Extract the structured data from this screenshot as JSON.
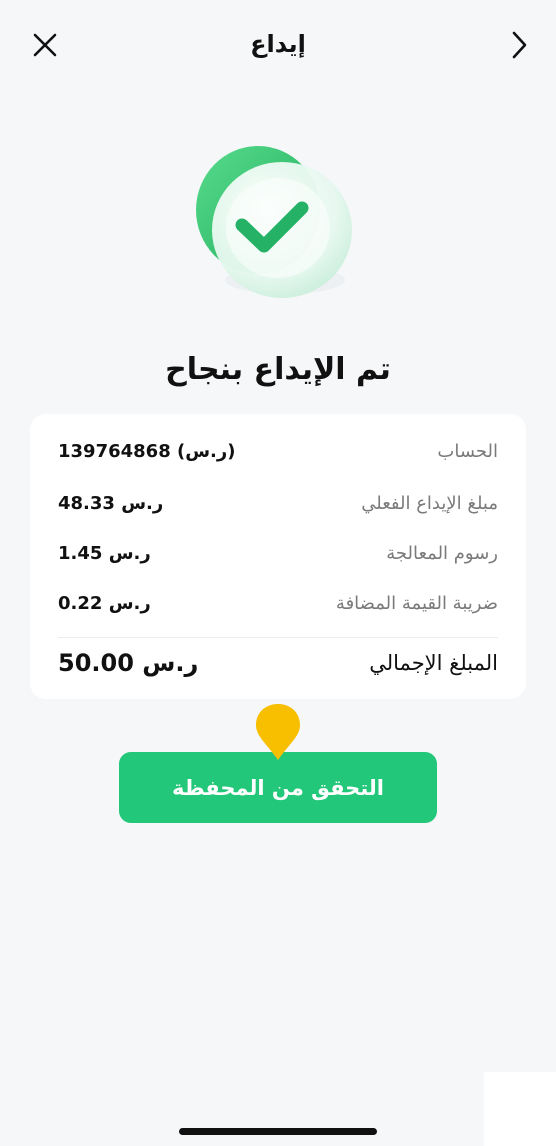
{
  "header": {
    "title": "إيداع",
    "close_icon": "close-icon",
    "back_icon": "chevron-right-icon"
  },
  "status": {
    "title": "تم الإيداع بنجاح",
    "icon": "success-check-icon",
    "accent_color": "#23c77a"
  },
  "details": {
    "account": {
      "label": "الحساب",
      "value": "139764868 (ر.س)"
    },
    "actual_deposit": {
      "label": "مبلغ الإيداع الفعلي",
      "value": "48.33 ر.س"
    },
    "processing_fee": {
      "label": "رسوم المعالجة",
      "value": "1.45 ر.س"
    },
    "vat": {
      "label": "ضريبة القيمة المضافة",
      "value": "0.22 ر.س"
    },
    "total": {
      "label": "المبلغ الإجمالي",
      "value": "50.00 ر.س"
    }
  },
  "actions": {
    "check_wallet_label": "التحقق من المحفظة"
  },
  "pointer": {
    "icon": "location-pin-icon",
    "color": "#f7bf00"
  }
}
